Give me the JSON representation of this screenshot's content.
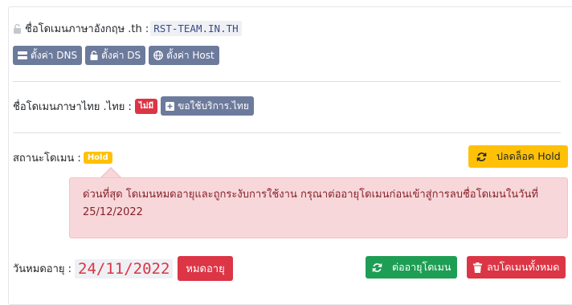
{
  "domain_section": {
    "label": "ชื่อโดเมนภาษาอังกฤษ .th :",
    "domain": "RST-TEAM.IN.TH",
    "buttons": [
      {
        "label": "ตั้งค่า DNS",
        "icon": "server-icon"
      },
      {
        "label": "ตั้งค่า DS",
        "icon": "lock-icon"
      },
      {
        "label": "ตั้งค่า Host",
        "icon": "globe-icon"
      }
    ]
  },
  "thai_domain_section": {
    "label": "ชื่อโดเมนภาษาไทย .ไทย :",
    "badge": "ไม่มี",
    "request_button": "ขอใช้บริการ.ไทย"
  },
  "status_section": {
    "label": "สถานะโดเมน :",
    "badge": "Hold",
    "unlock_button": "ปลดล็อค Hold"
  },
  "alert": {
    "text": "ด่วนที่สุด โดเมนหมดอายุและถูกระงับการใช้งาน กรุณาต่ออายุโดเมนก่อนเข้าสู่การลบชื่อโดเมนในวันที่ 25/12/2022"
  },
  "expiry_section": {
    "label": "วันหมดอายุ :",
    "date": "24/11/2022",
    "expired_badge": "หมดอายุ",
    "renew_button": "ต่ออายุโดเมน",
    "delete_button": "ลบโดเมนทั้งหมด"
  },
  "colors": {
    "slate": "#6c7a9c",
    "danger": "#dc3545",
    "warning": "#ffc107",
    "success": "#1e9e54",
    "alert_bg": "#f8d7da"
  }
}
